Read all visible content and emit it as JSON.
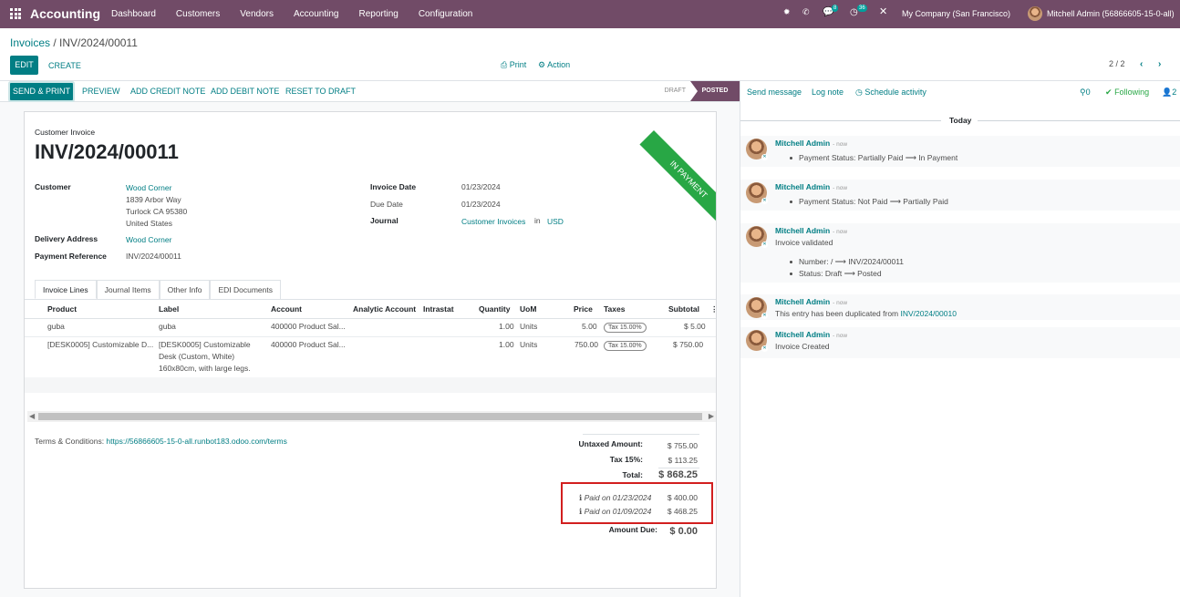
{
  "nav": {
    "brand": "Accounting",
    "menu": [
      "Dashboard",
      "Customers",
      "Vendors",
      "Accounting",
      "Reporting",
      "Configuration"
    ],
    "chat_count": "8",
    "activity_count": "36",
    "company": "My Company (San Francisco)",
    "user": "Mitchell Admin (56866605-15-0-all)"
  },
  "control": {
    "breadcrumb_root": "Invoices",
    "breadcrumb_sep": " / ",
    "breadcrumb_current": "INV/2024/00011",
    "edit": "EDIT",
    "create": "CREATE",
    "print": "Print",
    "action": "Action",
    "pager": "2 / 2"
  },
  "statusbar": {
    "send_print": "SEND & PRINT",
    "preview": "PREVIEW",
    "add_credit_note": "ADD CREDIT NOTE",
    "add_debit_note": "ADD DEBIT NOTE",
    "reset_to_draft": "RESET TO DRAFT",
    "stage_draft": "DRAFT",
    "stage_posted": "POSTED"
  },
  "invoice": {
    "ribbon": "IN PAYMENT",
    "type": "Customer Invoice",
    "number": "INV/2024/00011",
    "customer_label": "Customer",
    "customer_name": "Wood Corner",
    "customer_address": [
      "1839 Arbor Way",
      "Turlock CA 95380",
      "United States"
    ],
    "delivery_label": "Delivery Address",
    "delivery_value": "Wood Corner",
    "payref_label": "Payment Reference",
    "payref_value": "INV/2024/00011",
    "invoice_date_label": "Invoice Date",
    "invoice_date": "01/23/2024",
    "due_date_label": "Due Date",
    "due_date": "01/23/2024",
    "journal_label": "Journal",
    "journal": "Customer Invoices",
    "journal_in": "in",
    "currency": "USD"
  },
  "tabs": [
    "Invoice Lines",
    "Journal Items",
    "Other Info",
    "EDI Documents"
  ],
  "lines": {
    "headers": [
      "Product",
      "Label",
      "Account",
      "Analytic Account",
      "Intrastat",
      "Quantity",
      "UoM",
      "Price",
      "Taxes",
      "Subtotal"
    ],
    "rows": [
      {
        "product": "guba",
        "label": [
          "guba"
        ],
        "account": "400000 Product Sal...",
        "quantity": "1.00",
        "uom": "Units",
        "price": "5.00",
        "tax": "Tax 15.00%",
        "subtotal": "$ 5.00"
      },
      {
        "product": "[DESK0005] Customizable D...",
        "label": [
          "[DESK0005] Customizable",
          "Desk (Custom, White)",
          "160x80cm, with large legs."
        ],
        "account": "400000 Product Sal...",
        "quantity": "1.00",
        "uom": "Units",
        "price": "750.00",
        "tax": "Tax 15.00%",
        "subtotal": "$ 750.00"
      }
    ]
  },
  "terms": {
    "label": "Terms & Conditions: ",
    "link": "https://56866605-15-0-all.runbot183.odoo.com/terms"
  },
  "totals": {
    "untaxed_label": "Untaxed Amount:",
    "untaxed": "$ 755.00",
    "tax_label": "Tax 15%:",
    "tax": "$ 113.25",
    "total_label": "Total:",
    "total": "$ 868.25",
    "payments": [
      {
        "label": "Paid on 01/23/2024",
        "amount": "$ 400.00"
      },
      {
        "label": "Paid on 01/09/2024",
        "amount": "$ 468.25"
      }
    ],
    "due_label": "Amount Due:",
    "due": "$ 0.00"
  },
  "chatter": {
    "send_message": "Send message",
    "log_note": "Log note",
    "schedule_activity": "Schedule activity",
    "attachments": "0",
    "following": "Following",
    "followers": "2",
    "today": "Today",
    "messages": [
      {
        "author": "Mitchell Admin",
        "time": "- now",
        "lines": [
          "Payment Status: Partially Paid ⟶ In Payment"
        ]
      },
      {
        "author": "Mitchell Admin",
        "time": "- now",
        "lines": [
          "Payment Status: Not Paid ⟶ Partially Paid"
        ]
      },
      {
        "author": "Mitchell Admin",
        "time": "- now",
        "body": "Invoice validated",
        "lines": [
          "Number: / ⟶ INV/2024/00011",
          "Status: Draft ⟶ Posted"
        ]
      },
      {
        "author": "Mitchell Admin",
        "time": "- now",
        "body": "This entry has been duplicated from ",
        "body_link": "INV/2024/00010"
      },
      {
        "author": "Mitchell Admin",
        "time": "- now",
        "body": "Invoice Created"
      }
    ]
  }
}
